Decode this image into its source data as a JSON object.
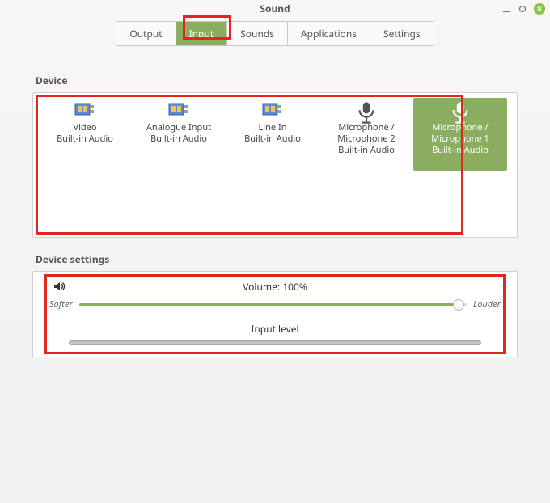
{
  "window": {
    "title": "Sound"
  },
  "tabs": {
    "output": "Output",
    "input": "Input",
    "sounds": "Sounds",
    "applications": "Applications",
    "settings": "Settings"
  },
  "sections": {
    "device_label": "Device",
    "device_settings_label": "Device settings"
  },
  "devices": [
    {
      "name": "Video",
      "sub": "Built-in Audio",
      "icon": "card"
    },
    {
      "name": "Analogue Input",
      "sub": "Built-in Audio",
      "icon": "card"
    },
    {
      "name": "Line In",
      "sub": "Built-in Audio",
      "icon": "card"
    },
    {
      "name_l1": "Microphone /",
      "name_l2": "Microphone 2",
      "sub": "Built-in Audio",
      "icon": "mic"
    },
    {
      "name_l1": "Microphone /",
      "name_l2": "Microphone 1",
      "sub": "Built-in Audio",
      "icon": "mic",
      "selected": true
    }
  ],
  "volume": {
    "label": "Volume: 100%",
    "softer": "Softer",
    "louder": "Louder",
    "percent": 100,
    "input_level_label": "Input level"
  },
  "icons": {
    "speaker": "speaker-icon",
    "mic": "mic-icon",
    "card": "soundcard-icon"
  }
}
